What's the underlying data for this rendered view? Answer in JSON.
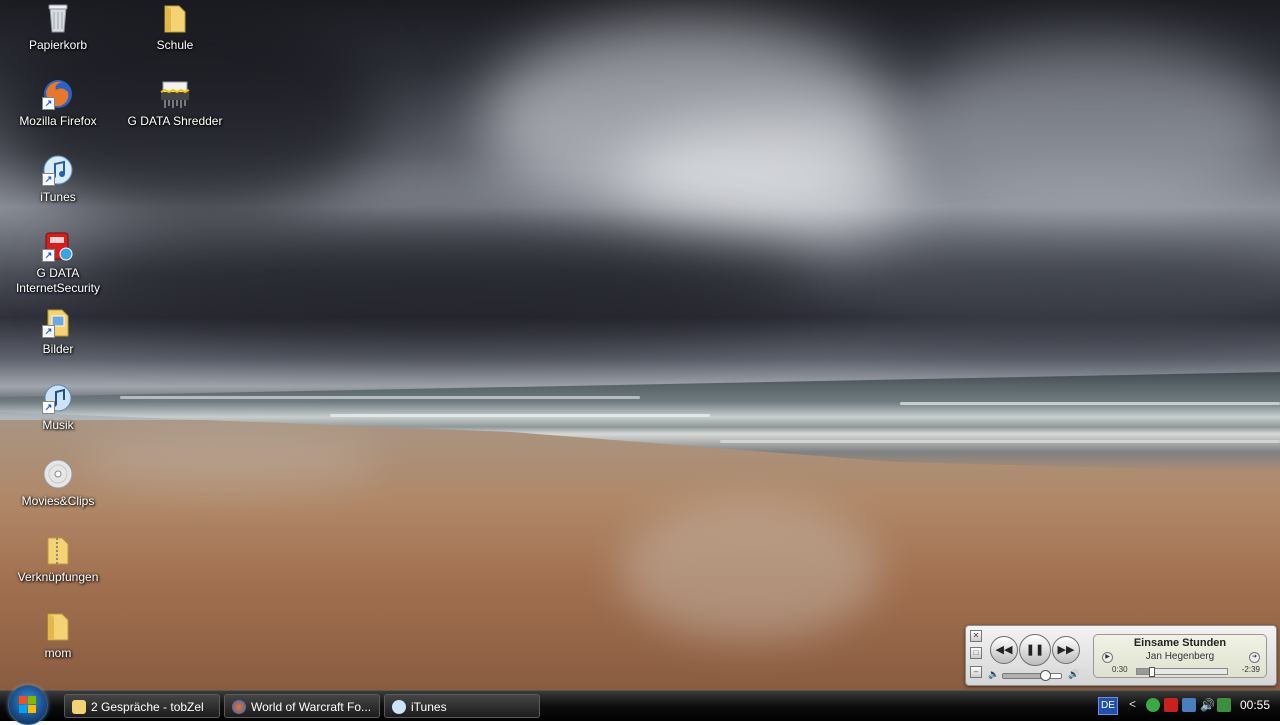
{
  "desktop": {
    "icons": [
      {
        "label": "Papierkorb",
        "icon": "recycle-bin-icon"
      },
      {
        "label": "Schule",
        "icon": "folder-icon"
      },
      {
        "label": "Mozilla Firefox",
        "icon": "firefox-icon"
      },
      {
        "label": "G DATA Shredder",
        "icon": "shredder-icon"
      },
      {
        "label": "iTunes",
        "icon": "itunes-icon"
      },
      {
        "label": "G DATA InternetSecurity",
        "icon": "gdata-icon"
      },
      {
        "label": "Bilder",
        "icon": "pictures-folder-icon"
      },
      {
        "label": "Musik",
        "icon": "music-folder-icon"
      },
      {
        "label": "Movies&Clips",
        "icon": "disc-icon"
      },
      {
        "label": "Verknüpfungen",
        "icon": "zip-folder-icon"
      },
      {
        "label": "mom",
        "icon": "folder-icon"
      }
    ]
  },
  "player": {
    "song_title": "Einsame Stunden",
    "artist": "Jan Hegenberg",
    "elapsed": "0:30",
    "remaining": "-2:39",
    "progress_fraction": 0.16,
    "volume_fraction": 0.72,
    "state": "playing"
  },
  "taskbar": {
    "tasks": [
      {
        "label": "2 Gespräche - tobZel",
        "icon": "folder-icon"
      },
      {
        "label": "World of Warcraft Fo...",
        "icon": "firefox-icon"
      },
      {
        "label": "iTunes",
        "icon": "itunes-icon"
      }
    ],
    "language": "DE",
    "chevron": "<",
    "clock": "00:55"
  },
  "colors": {
    "taskbar": "#0d0d0d",
    "language_badge": "#1f4fb3"
  }
}
